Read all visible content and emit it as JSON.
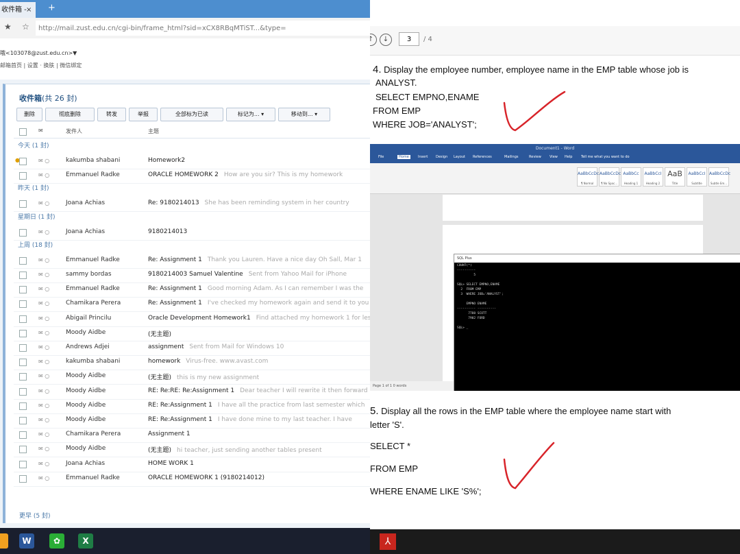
{
  "browser": {
    "tab_title": "收件箱 -",
    "tab_close": "×",
    "new_tab": "+",
    "address": "http://mail.zust.edu.cn/cgi-bin/frame_html?sid=xCX8RBqMTiST...&type=",
    "address_parts": {
      "pre": "http://mail.",
      "domain": "zust.edu.cn",
      "post": "/cgi-bin/frame_html?sid=xCX8RBqMTiST...&type="
    }
  },
  "mail": {
    "account": "哦<103078@zust.edu.cn>▼",
    "account_links": "邮箱首页 | 设置 · 换肤 | 微信绑定",
    "inbox_title": "收件箱",
    "inbox_count": "(共 26 封)",
    "toolbar": [
      "删除",
      "彻底删除",
      "转发",
      "举报",
      "全部标为已读",
      "标记为...",
      "移动到..."
    ],
    "columns": {
      "sender": "发件人",
      "subject": "主题"
    },
    "groups": [
      {
        "label": "今天 (1 封)",
        "rows": [
          {
            "sender": "kakumba shabani",
            "subject": "Homework2",
            "preview": "",
            "marked": true
          },
          {
            "sender": "Emmanuel Radke",
            "subject": "ORACLE HOMEWORK 2",
            "preview": "How are you sir? This is my homework"
          }
        ]
      },
      {
        "label": "昨天 (1 封)",
        "rows": [
          {
            "sender": "Joana Achias",
            "subject": "Re: 9180214013",
            "preview": "She has been reminding system in her country"
          }
        ]
      },
      {
        "label": "星期日 (1 封)",
        "rows": [
          {
            "sender": "Joana Achias",
            "subject": "9180214013",
            "preview": ""
          }
        ]
      },
      {
        "label": "上周 (18 封)",
        "rows": [
          {
            "sender": "Emmanuel Radke",
            "subject": "Re: Assignment 1",
            "preview": "Thank you Lauren. Have a nice day Oh Sall, Mar 1"
          },
          {
            "sender": "sammy bordas",
            "subject": "9180214003 Samuel Valentine",
            "preview": "Sent from Yahoo Mail for iPhone"
          },
          {
            "sender": "Emmanuel Radke",
            "subject": "Re: Assignment 1",
            "preview": "Good morning Adam. As I can remember I was the"
          },
          {
            "sender": "Chamikara Perera",
            "subject": "Re: Assignment 1",
            "preview": "I've checked my homework again and send it to you"
          },
          {
            "sender": "Abigail Princilu",
            "subject": "Oracle Development Homework1",
            "preview": "Find attached my homework 1 for lesson"
          },
          {
            "sender": "Moody Aidbe",
            "subject": "(无主题)",
            "preview": ""
          },
          {
            "sender": "Andrews Adjei",
            "subject": "assignment",
            "preview": "Sent from Mail for Windows 10"
          },
          {
            "sender": "kakumba shabani",
            "subject": "homework",
            "preview": "Virus-free. www.avast.com"
          },
          {
            "sender": "Moody Aidbe",
            "subject": "(无主题)",
            "preview": "this is my new assignment"
          },
          {
            "sender": "Moody Aidbe",
            "subject": "RE: Re:RE: Re:Assignment 1",
            "preview": "Dear teacher I will rewrite it then forward"
          },
          {
            "sender": "Moody Aidbe",
            "subject": "RE: Re:Assignment 1",
            "preview": "I have all the practice from last semester which"
          },
          {
            "sender": "Moody Aidbe",
            "subject": "RE: Re:Assignment 1",
            "preview": "I have done mine to my last teacher. I have"
          },
          {
            "sender": "Chamikara Perera",
            "subject": "Assignment 1",
            "preview": ""
          },
          {
            "sender": "Moody Aidbe",
            "subject": "(无主题)",
            "preview": "hi teacher, just sending another tables present"
          },
          {
            "sender": "Joana Achias",
            "subject": "HOME WORK 1",
            "preview": ""
          },
          {
            "sender": "Emmanuel Radke",
            "subject": "ORACLE HOMEWORK 1 (9180214012)",
            "preview": ""
          }
        ]
      }
    ],
    "next_group": "更早 (5 封)"
  },
  "pdf": {
    "page": "3",
    "total": "/ 4",
    "q4": {
      "number": "4.",
      "text": "Display the employee number, employee name in the EMP table whose job is",
      "text2": "ANALYST.",
      "sql": [
        "SELECT EMPNO,ENAME",
        "FROM EMP",
        "WHERE JOB='ANALYST';"
      ]
    },
    "q5": {
      "number": "5.",
      "text": "Display all the rows in the EMP table where the employee name start with",
      "text2": "letter 'S'.",
      "sql": [
        "SELECT *",
        "FROM EMP",
        "WHERE ENAME LIKE 'S%';"
      ]
    }
  },
  "word_shot": {
    "title": "Document1 - Word",
    "tabs": [
      "File",
      "Home",
      "Insert",
      "Design",
      "Layout",
      "References",
      "Mailings",
      "Review",
      "View",
      "Help",
      "Tell me what you want to do"
    ],
    "styles": [
      {
        "sample": "AaBbCcDc",
        "name": "¶ Normal"
      },
      {
        "sample": "AaBbCcDc",
        "name": "¶ No Spac..."
      },
      {
        "sample": "AaBbCc",
        "name": "Heading 1"
      },
      {
        "sample": "AaBbCcI",
        "name": "Heading 2"
      },
      {
        "sample": "AaB",
        "name": "Title"
      },
      {
        "sample": "AaBbCcI",
        "name": "Subtitle"
      },
      {
        "sample": "AaBbCcDc",
        "name": "Subtle Em..."
      }
    ],
    "console_title": "SQL Plus",
    "console_lines": [
      "COUNT(*)",
      "----------",
      "         5",
      "",
      "SQL> SELECT EMPNO,ENAME",
      "  2  FROM EMP",
      "  3  WHERE JOB='ANALYST';",
      "",
      "     EMPNO ENAME",
      "---------- ----------",
      "      7788 SCOTT",
      "      7902 FORD",
      "",
      "SQL> _"
    ],
    "status": "Page 1 of 1   0 words"
  },
  "colors": {
    "check": "#d8242a",
    "tabbar": "#4d8ecf",
    "word": "#2b579a"
  }
}
